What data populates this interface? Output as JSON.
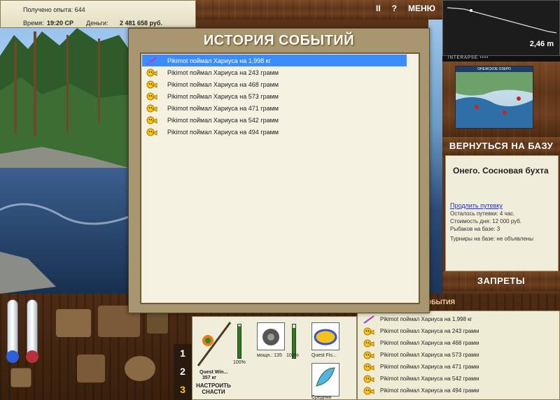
{
  "stats": {
    "exp_label": "Получено опыта:",
    "exp_value": "644",
    "time_label": "Время:",
    "time_value": "19:20 СР",
    "money_label": "Деньги:",
    "money_value": "2 481 658 руб."
  },
  "topmenu": {
    "pause": "II",
    "help": "?",
    "menu": "МЕНЮ"
  },
  "depth": {
    "value": "2,46 m"
  },
  "brand": "INTERAPSE ••••",
  "lakemap": {
    "title": "ОНЕЖСКОЕ ОЗЕРО"
  },
  "buttons": {
    "base": "ВЕРНУТЬСЯ НА БАЗУ",
    "bans": "ЗАПРЕТЫ",
    "setup": "НАСТРОИТЬ СНАСТИ"
  },
  "info": {
    "place": "Онего. Сосновая бухта",
    "extend": "Продлить путевку",
    "left": "Осталось путевки: 4 час.",
    "cost": "Стоимость дня: 12 000 руб.",
    "fishers": "Рыбаков на базе: 3",
    "tournaments": "Турниры на базе: не объявлены"
  },
  "tabs": [
    "1",
    "2",
    "3"
  ],
  "tackle": {
    "rod_name": "Quest Win...",
    "rod_weight": "357 кг",
    "rod_pct": "100%",
    "reel_power": "мощн.: 135",
    "reel_pct": "100%",
    "line_name": "Quest Fis...",
    "lure_label": "Средняя",
    "rod_meter": 0.95,
    "reel_meter": 0.9
  },
  "modal": {
    "title": "ИСТОРИЯ СОБЫТИЙ",
    "events": [
      {
        "text": "Pikimot поймал Хариуса на 1,998 кг",
        "selected": true,
        "icon": "lure-icon"
      },
      {
        "text": "Pikimot поймал Хариуса на 243 грамм",
        "selected": false,
        "icon": "smiley-icon"
      },
      {
        "text": "Pikimot поймал Хариуса на 468 грамм",
        "selected": false,
        "icon": "smiley-icon"
      },
      {
        "text": "Pikimot поймал Хариуса на 573 грамм",
        "selected": false,
        "icon": "smiley-icon"
      },
      {
        "text": "Pikimot поймал Хариуса на 471 грамм",
        "selected": false,
        "icon": "smiley-icon"
      },
      {
        "text": "Pikimot поймал Хариуса на 542 грамм",
        "selected": false,
        "icon": "smiley-icon"
      },
      {
        "text": "Pikimot поймал Хариуса на 494 грамм",
        "selected": false,
        "icon": "smiley-icon"
      }
    ]
  },
  "smalllog": {
    "header": "СОБЫТИЯ",
    "events": [
      {
        "text": "Pikimot поймал Хариуса на 1,998 кг",
        "icon": "lure-icon"
      },
      {
        "text": "Pikimot поймал Хариуса на 243 грамм",
        "icon": "smiley-icon"
      },
      {
        "text": "Pikimot поймал Хариуса на 468 грамм",
        "icon": "smiley-icon"
      },
      {
        "text": "Pikimot поймал Хариуса на 573 грамм",
        "icon": "smiley-icon"
      },
      {
        "text": "Pikimot поймал Хариуса на 471 грамм",
        "icon": "smiley-icon"
      },
      {
        "text": "Pikimot поймал Хариуса на 542 грамм",
        "icon": "smiley-icon"
      },
      {
        "text": "Pikimot поймал Хариуса на 494 грамм",
        "icon": "smiley-icon"
      }
    ]
  }
}
